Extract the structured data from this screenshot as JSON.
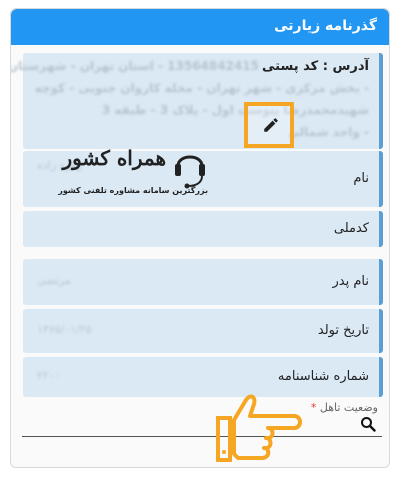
{
  "header": {
    "title": "گذرنامه زیارتی"
  },
  "address": {
    "label": "آدرس : کد پستی",
    "value_lines": [
      "13564842415 - استان تهران - شهرستان تهران",
      "- بخش مرکزی - شهر تهران - محله کاروان جنوبی - کوچه",
      "شهیدمحمدرضا پیوست اول - پلاک 3 - طبقه 3",
      "- واحد شمالی"
    ]
  },
  "fields": [
    {
      "label": "نام",
      "value": "زهره زاده"
    },
    {
      "label": "کدملی",
      "value": ""
    },
    {
      "label": "نام پدر",
      "value": "مرتضی"
    },
    {
      "label": "تاریخ تولد",
      "value": "۱۳۶۵/۰۱/۲۵"
    },
    {
      "label": "شماره شناسنامه",
      "value": "۲۲۰۰"
    }
  ],
  "marital": {
    "label": "وضعیت تاهل",
    "required_mark": "*"
  },
  "watermark": {
    "title": "همراه کشور",
    "subtitle": "بزرگترین سامانه مشاوره تلفنی کشور"
  },
  "colors": {
    "header": "#2196f3",
    "highlight": "#f5a623",
    "card": "#dbe9f5",
    "card_border": "#5b9fd2"
  },
  "icons": {
    "edit": "pencil-icon",
    "search": "search-icon",
    "pointer": "pointing-hand-icon"
  }
}
